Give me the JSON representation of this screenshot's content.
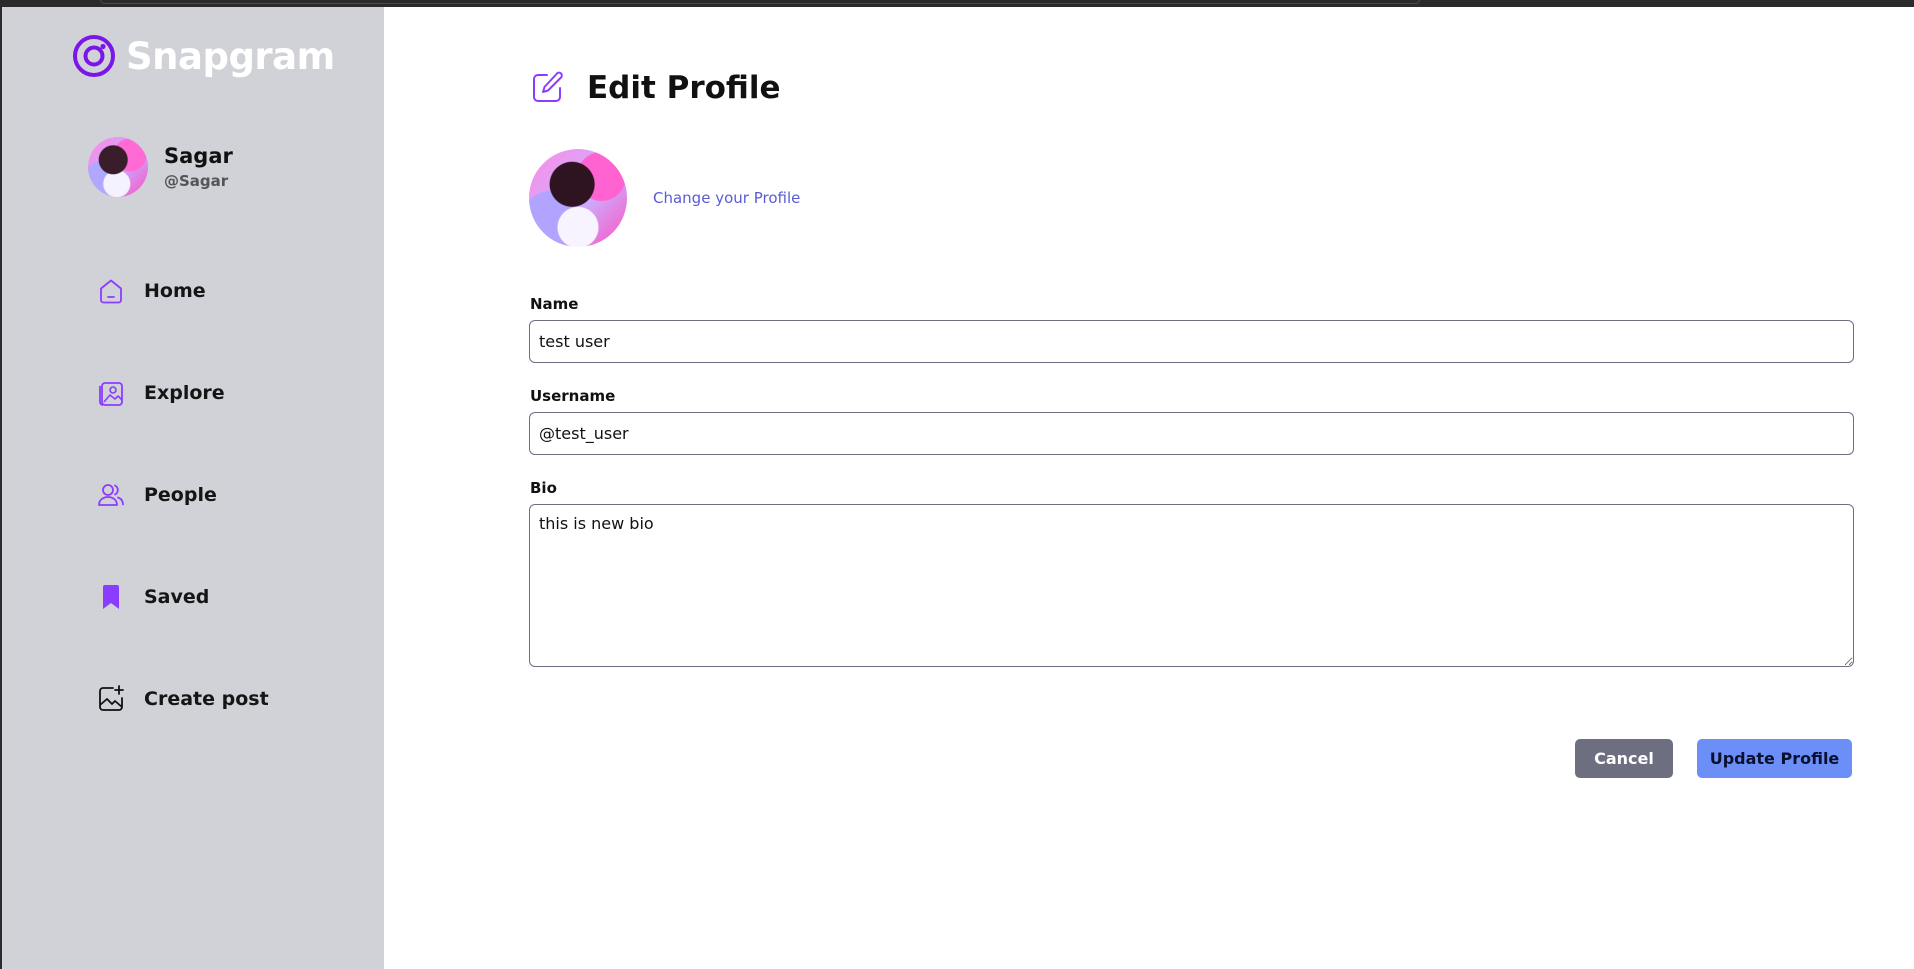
{
  "app": {
    "name": "Snapgram",
    "accent": "#877eff"
  },
  "user": {
    "name": "Sagar",
    "handle": "@Sagar"
  },
  "sidebar": {
    "items": [
      {
        "label": "Home",
        "icon": "home-icon"
      },
      {
        "label": "Explore",
        "icon": "explore-icon"
      },
      {
        "label": "People",
        "icon": "people-icon"
      },
      {
        "label": "Saved",
        "icon": "bookmark-icon"
      },
      {
        "label": "Create post",
        "icon": "create-post-icon"
      }
    ]
  },
  "page": {
    "title": "Edit Profile",
    "icon": "edit-icon"
  },
  "profile_photo": {
    "change_label": "Change your Profile"
  },
  "form": {
    "name": {
      "label": "Name",
      "value": "test user"
    },
    "username": {
      "label": "Username",
      "value": "@test_user"
    },
    "bio": {
      "label": "Bio",
      "value": "this is new bio"
    }
  },
  "actions": {
    "cancel": "Cancel",
    "update": "Update Profile"
  },
  "colors": {
    "sidebar_bg": "#d0d2d7",
    "cancel_bg": "#6d6f81",
    "update_bg": "#6b8ef7",
    "link": "#5a5bd8",
    "icon": "#8b3dff"
  }
}
